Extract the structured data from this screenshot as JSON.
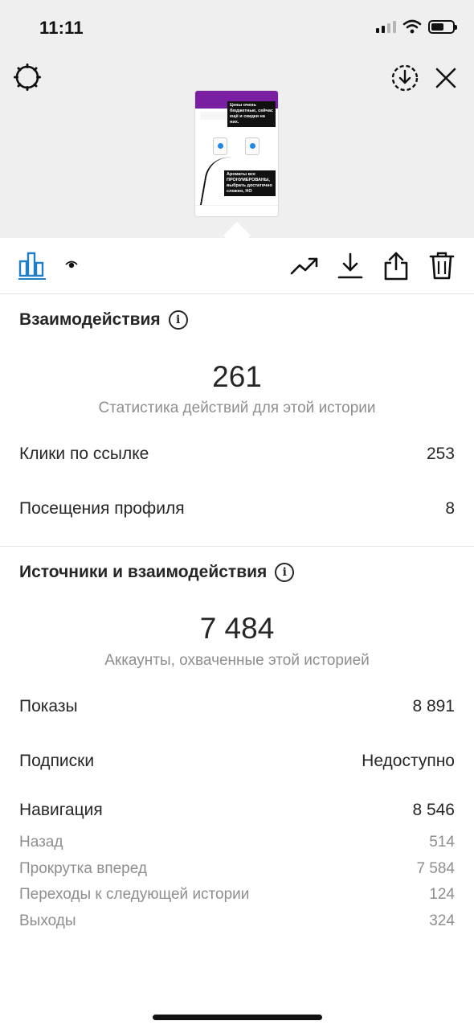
{
  "status": {
    "time": "11:11"
  },
  "story_preview": {
    "note_top": "Цены очень бюджетные, сейчас ещё и скидки на них.",
    "note_bottom": "Ароматы все ПРОНУМЕРОВАНЫ, выбрать достаточно сложно, НО"
  },
  "interactions": {
    "title": "Взаимодействия",
    "total": "261",
    "caption": "Статистика действий для этой истории",
    "rows": [
      {
        "label": "Клики по ссылке",
        "value": "253"
      },
      {
        "label": "Посещения профиля",
        "value": "8"
      }
    ]
  },
  "discovery": {
    "title": "Источники и взаимодействия",
    "total": "7 484",
    "caption": "Аккаунты, охваченные этой историей",
    "impressions": {
      "label": "Показы",
      "value": "8 891"
    },
    "follows": {
      "label": "Подписки",
      "value": "Недоступно"
    },
    "navigation": {
      "label": "Навигация",
      "value": "8 546",
      "items": [
        {
          "label": "Назад",
          "value": "514"
        },
        {
          "label": "Прокрутка вперед",
          "value": "7 584"
        },
        {
          "label": "Переходы к следующей истории",
          "value": "124"
        },
        {
          "label": "Выходы",
          "value": "324"
        }
      ]
    }
  },
  "colors": {
    "accent": "#1e7fc7",
    "text": "#262626",
    "muted": "#8e8e8e",
    "header_bg": "#efefef"
  }
}
